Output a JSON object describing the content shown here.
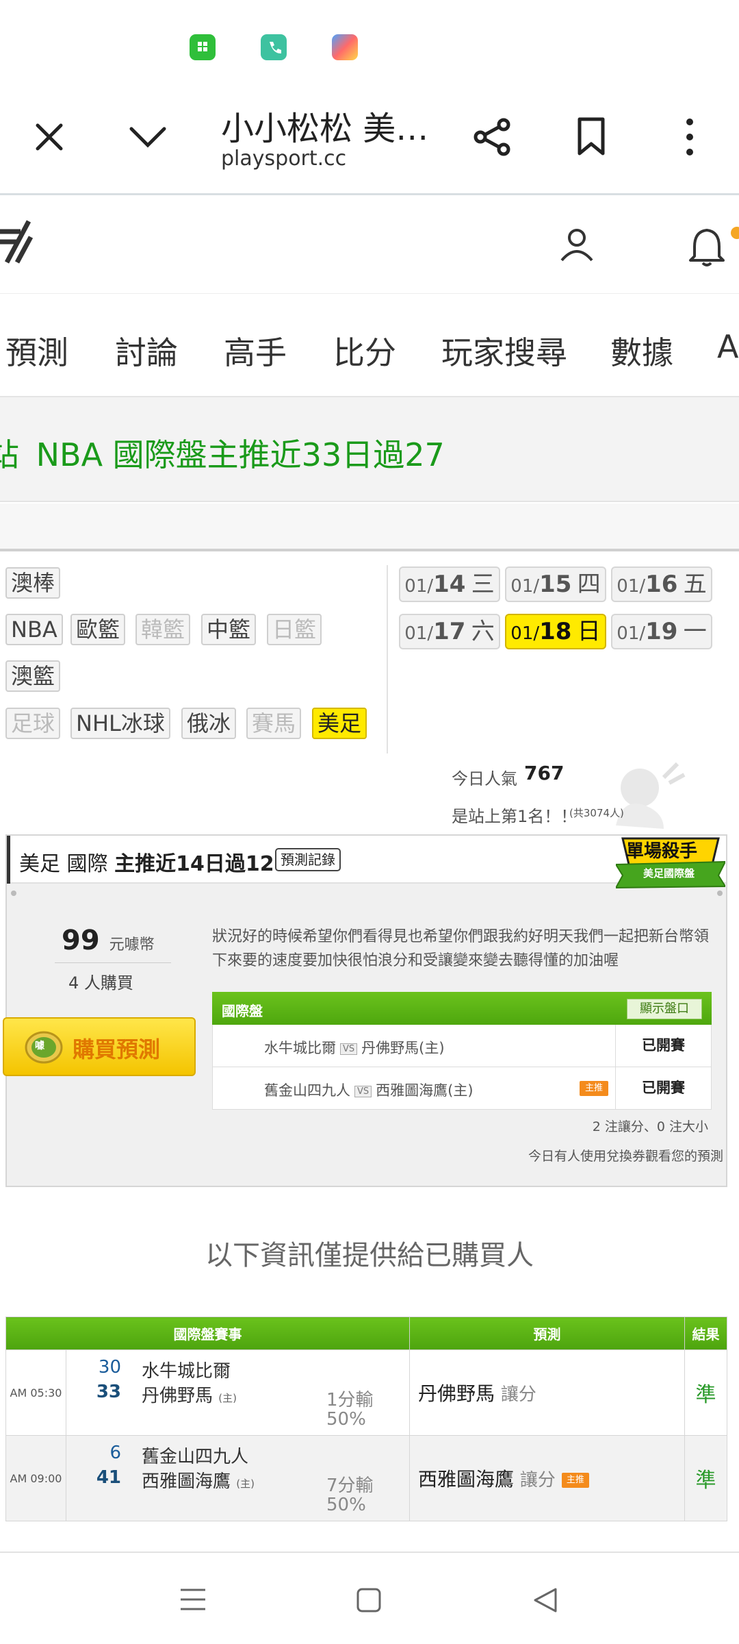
{
  "browser": {
    "title": "小小松松 美…",
    "url": "playsport.cc"
  },
  "nav": {
    "items": [
      "預測",
      "討論",
      "高手",
      "比分",
      "玩家搜尋",
      "數據",
      "A"
    ]
  },
  "banner": {
    "text": "NBA 國際盤主推近33日過27",
    "prefix": "站"
  },
  "sports": {
    "row1": [
      "澳棒"
    ],
    "row2": [
      "NBA",
      "歐籃",
      "韓籃",
      "中籃",
      "日籃"
    ],
    "row3": [
      "澳籃"
    ],
    "row4": [
      "足球",
      "NHL冰球",
      "俄冰",
      "賽馬",
      "美足"
    ]
  },
  "dates": [
    {
      "prefix": "01/",
      "day": "14",
      "weekday": "三"
    },
    {
      "prefix": "01/",
      "day": "15",
      "weekday": "四"
    },
    {
      "prefix": "01/",
      "day": "16",
      "weekday": "五"
    },
    {
      "prefix": "01/",
      "day": "17",
      "weekday": "六"
    },
    {
      "prefix": "01/",
      "day": "18",
      "weekday": "日"
    },
    {
      "prefix": "01/",
      "day": "19",
      "weekday": "一"
    }
  ],
  "popularity": {
    "label": "今日人氣",
    "value": "767",
    "rank_text": "是站上第1名！！",
    "total": "(共3074人)"
  },
  "prediction": {
    "title_prefix": "美足 國際",
    "title_bold": "主推近14日過12",
    "record_button": "預測記錄",
    "badge_title": "單場殺手",
    "badge_sub": "美足國際盤",
    "price": "99",
    "price_unit": "元噱幣",
    "buyers": "4 人購買",
    "buy_button": "購買預測",
    "buy_icon": "噱",
    "description": "狀況好的時候希望你們看得見也希望你們跟我約好明天我們一起把新台幣領下來要的速度要加快很怕浪分和受讓變來變去聽得懂的加油喔",
    "table_header": "國際盤",
    "show_button": "顯示盤口",
    "vs": "VS",
    "matches": [
      {
        "away": "水牛城比爾",
        "home": "丹佛野馬(主)",
        "status": "已開賽",
        "star": ""
      },
      {
        "away": "舊金山四九人",
        "home": "西雅圖海鷹(主)",
        "status": "已開賽",
        "star": "主推"
      }
    ],
    "bet_summary": "2 注讓分、0 注大小",
    "redeem_note": "今日有人使用兌換券觀看您的預測"
  },
  "info_note": "以下資訊僅提供給已購買人",
  "results": {
    "headers": [
      "國際盤賽事",
      "預測",
      "結果"
    ],
    "rows": [
      {
        "time": "AM 05:30",
        "away_score": "30",
        "away_team": "水牛城比爾",
        "home_score": "33",
        "home_team": "丹佛野馬",
        "home_tag": "(主)",
        "spread": "1分輸",
        "spread_pct": "50%",
        "pick": "丹佛野馬",
        "pick_type": "讓分",
        "star": "",
        "result": "準"
      },
      {
        "time": "AM 09:00",
        "away_score": "6",
        "away_team": "舊金山四九人",
        "home_score": "41",
        "home_team": "西雅圖海鷹",
        "home_tag": "(主)",
        "spread": "7分輸",
        "spread_pct": "50%",
        "pick": "西雅圖海鷹",
        "pick_type": "讓分",
        "star": "主推",
        "result": "準"
      }
    ]
  },
  "colors": {
    "accent_green": "#4ea70e",
    "highlight_yellow": "#ffea00",
    "banner_green": "#1a9a1a",
    "star_orange": "#f48b1c"
  }
}
